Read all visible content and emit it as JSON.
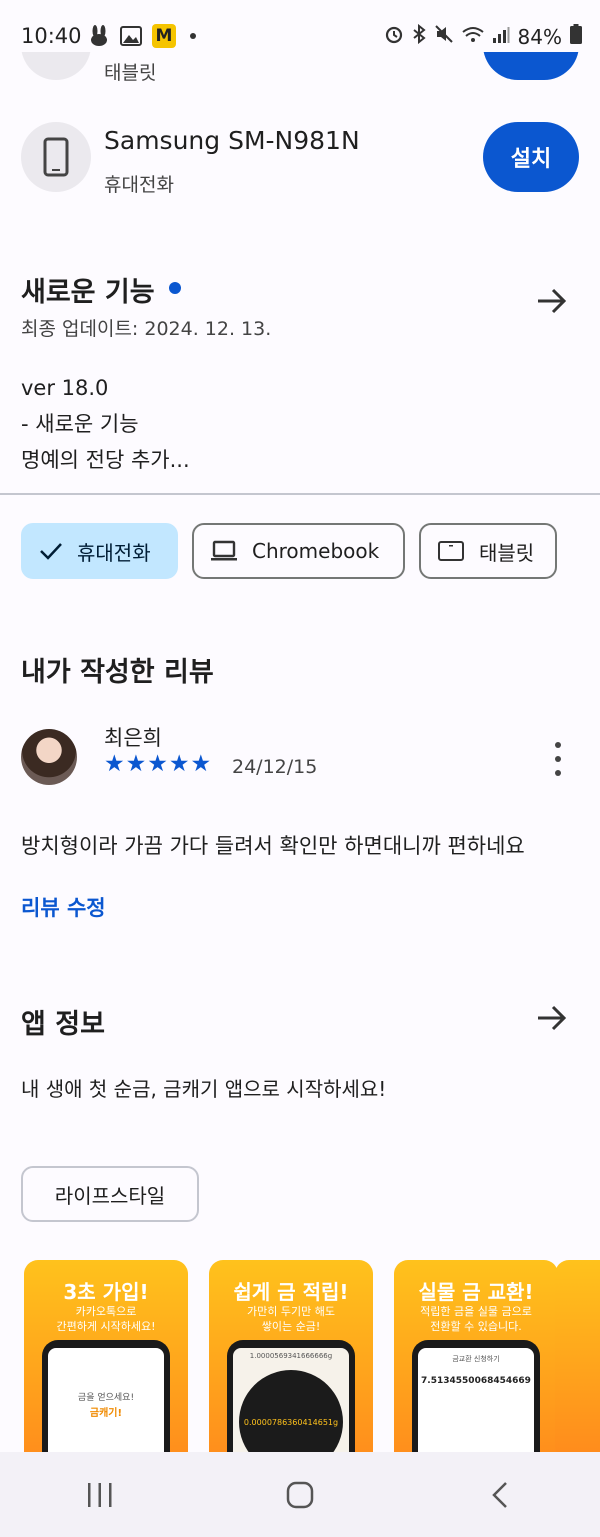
{
  "status_bar": {
    "time": "10:40",
    "battery": "84%",
    "left_icons": [
      "rabbit-icon",
      "gallery-icon",
      "m-app-icon"
    ],
    "m_badge": "M",
    "right_icons": [
      "alarm-icon",
      "bluetooth-icon",
      "mute-icon",
      "wifi-icon",
      "signal-icon",
      "battery-icon"
    ]
  },
  "devices": {
    "partial_label": "태블릿",
    "device_name": "Samsung SM-N981N",
    "device_type": "휴대전화",
    "install_label": "설치"
  },
  "whats_new": {
    "title": "새로운 기능",
    "updated": "최종 업데이트: 2024. 12. 13.",
    "notes": [
      "ver 18.0",
      "- 새로운 기능",
      "명예의 전당 추가..."
    ]
  },
  "device_chips": [
    {
      "label": "휴대전화",
      "selected": true
    },
    {
      "label": "Chromebook",
      "selected": false
    },
    {
      "label": "태블릿",
      "selected": false
    }
  ],
  "my_review": {
    "title": "내가 작성한 리뷰",
    "reviewer": "최은희",
    "rating": 5,
    "date": "24/12/15",
    "text": "방치형이라 가끔 가다 들려서 확인만 하면대니까 편하네요",
    "edit_label": "리뷰 수정"
  },
  "app_info": {
    "title": "앱 정보",
    "description": "내 생애 첫 순금, 금캐기 앱으로 시작하세요!",
    "category": "라이프스타일"
  },
  "screenshots": [
    {
      "title": "3초 가입!",
      "subtitle": "카카오톡으로\n간편하게 시작하세요!",
      "screen_line1": "금을 얻으세요!",
      "screen_line2": "금캐기!"
    },
    {
      "title": "쉽게 금 적립!",
      "subtitle": "가만히 두기만 해도\n쌓이는 순금!",
      "screen_line1": "1.0000569341666666g",
      "screen_line2": "0.0000786360414651g"
    },
    {
      "title": "실물 금 교환!",
      "subtitle": "적립한 금을 실물 금으로\n전환할 수 있습니다.",
      "screen_line1": "금교환 신청하기",
      "screen_line2": "7.5134550068454669"
    }
  ],
  "colors": {
    "primary": "#0b57d0",
    "chip_selected": "#c2e7ff",
    "background": "#fdfbff",
    "screenshot_orange": "#ff8a1c"
  }
}
